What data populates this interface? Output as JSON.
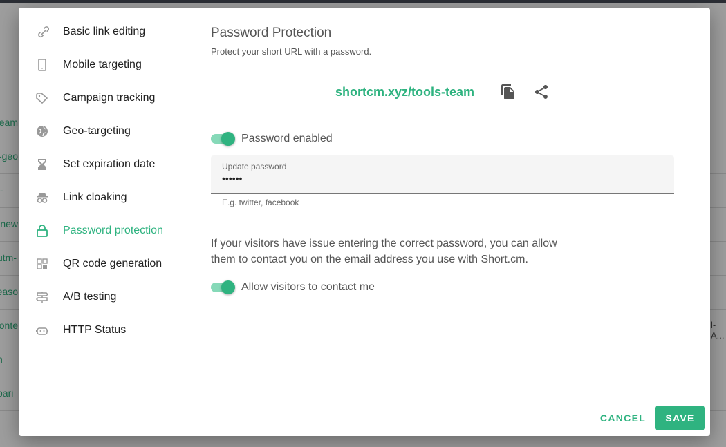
{
  "background": {
    "rows": [
      {
        "left": "tools-team",
        "right": ""
      },
      {
        "left": "tools-geo",
        "right": ""
      },
      {
        "left": "-t",
        "right": ""
      },
      {
        "left": "f-new",
        "right": ""
      },
      {
        "left": "-utm",
        "right": ""
      },
      {
        "left": "reaso",
        "right": ""
      },
      {
        "left": "conte",
        "right": "l-A..."
      },
      {
        "left": "n",
        "right": ""
      },
      {
        "left": "pari",
        "right": ""
      }
    ]
  },
  "sidebar": {
    "items": [
      {
        "label": "Basic link editing",
        "icon": "link-icon"
      },
      {
        "label": "Mobile targeting",
        "icon": "mobile-icon"
      },
      {
        "label": "Campaign tracking",
        "icon": "tag-icon"
      },
      {
        "label": "Geo-targeting",
        "icon": "globe-icon"
      },
      {
        "label": "Set expiration date",
        "icon": "hourglass-icon"
      },
      {
        "label": "Link cloaking",
        "icon": "incognito-icon"
      },
      {
        "label": "Password protection",
        "icon": "lock-icon",
        "active": true
      },
      {
        "label": "QR code generation",
        "icon": "qr-code-icon"
      },
      {
        "label": "A/B testing",
        "icon": "signpost-icon"
      },
      {
        "label": "HTTP Status",
        "icon": "robot-icon"
      }
    ]
  },
  "main": {
    "title": "Password Protection",
    "subtitle": "Protect your short URL with a password.",
    "short_url": "shortcm.xyz/tools-team",
    "password_toggle": {
      "label": "Password enabled",
      "on": true
    },
    "password_field": {
      "label": "Update password",
      "value": "••••••",
      "hint": "E.g. twitter, facebook"
    },
    "info_text": "If your visitors have issue entering the correct password, you can allow them to contact you on the email address you use with Short.cm.",
    "contact_toggle": {
      "label": "Allow visitors to contact me",
      "on": true
    }
  },
  "footer": {
    "cancel_label": "CANCEL",
    "save_label": "SAVE"
  },
  "colors": {
    "accent": "#2fb380",
    "overlay": "#9e9e9e"
  }
}
